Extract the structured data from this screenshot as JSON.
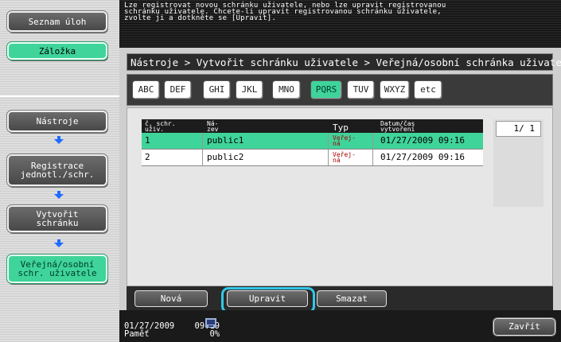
{
  "sidebar": {
    "task_list_label": "Seznam úloh",
    "bookmark_label": "Záložka",
    "steps": [
      {
        "label": "Nástroje"
      },
      {
        "label": "Registrace\njednotl./schr."
      },
      {
        "label": "Vytvořit\nschránku"
      },
      {
        "label": "Veřejná/osobní\nschr. uživatele"
      }
    ]
  },
  "header": {
    "message": "Lze registrovat novou schránku uživatele, nebo lze upravit registrovanou\nschránku uživatele. Chcete-li upravit registrovanou schránku uživatele,\nzvolte ji a dotkněte se [Upravit]."
  },
  "breadcrumb": "Nástroje > Vytvořit schránku uživatele > Veřejná/osobní schránka uživatele",
  "index_tabs": [
    {
      "label": "ABC",
      "selected": false
    },
    {
      "label": "DEF",
      "selected": false
    },
    {
      "label": "GHI",
      "selected": false
    },
    {
      "label": "JKL",
      "selected": false
    },
    {
      "label": "MNO",
      "selected": false
    },
    {
      "label": "PQRS",
      "selected": true
    },
    {
      "label": "TUV",
      "selected": false
    },
    {
      "label": "WXYZ",
      "selected": false
    },
    {
      "label": "etc",
      "selected": false
    }
  ],
  "table": {
    "columns": [
      "č. schr.\nuživ.",
      "Ná-\nzev",
      "Typ",
      "Datum/čas\nvytvoření"
    ],
    "rows": [
      {
        "number": "1",
        "name": "public1",
        "type": "Veřej-\nná",
        "date": "01/27/2009 09:16",
        "selected": true
      },
      {
        "number": "2",
        "name": "public2",
        "type": "Veřej-\nná",
        "date": "01/27/2009 09:16",
        "selected": false
      }
    ]
  },
  "pagination": "1/  1",
  "actions": {
    "new_label": "Nová",
    "edit_label": "Upravit",
    "delete_label": "Smazat"
  },
  "status": {
    "date": "01/27/2009",
    "time": "09:19",
    "memory_label": "Paměť",
    "memory_value": "0%"
  },
  "close_label": "Zavřít",
  "colors": {
    "accent_green": "#3fd49a",
    "highlight_cyan": "#33c8e8"
  }
}
